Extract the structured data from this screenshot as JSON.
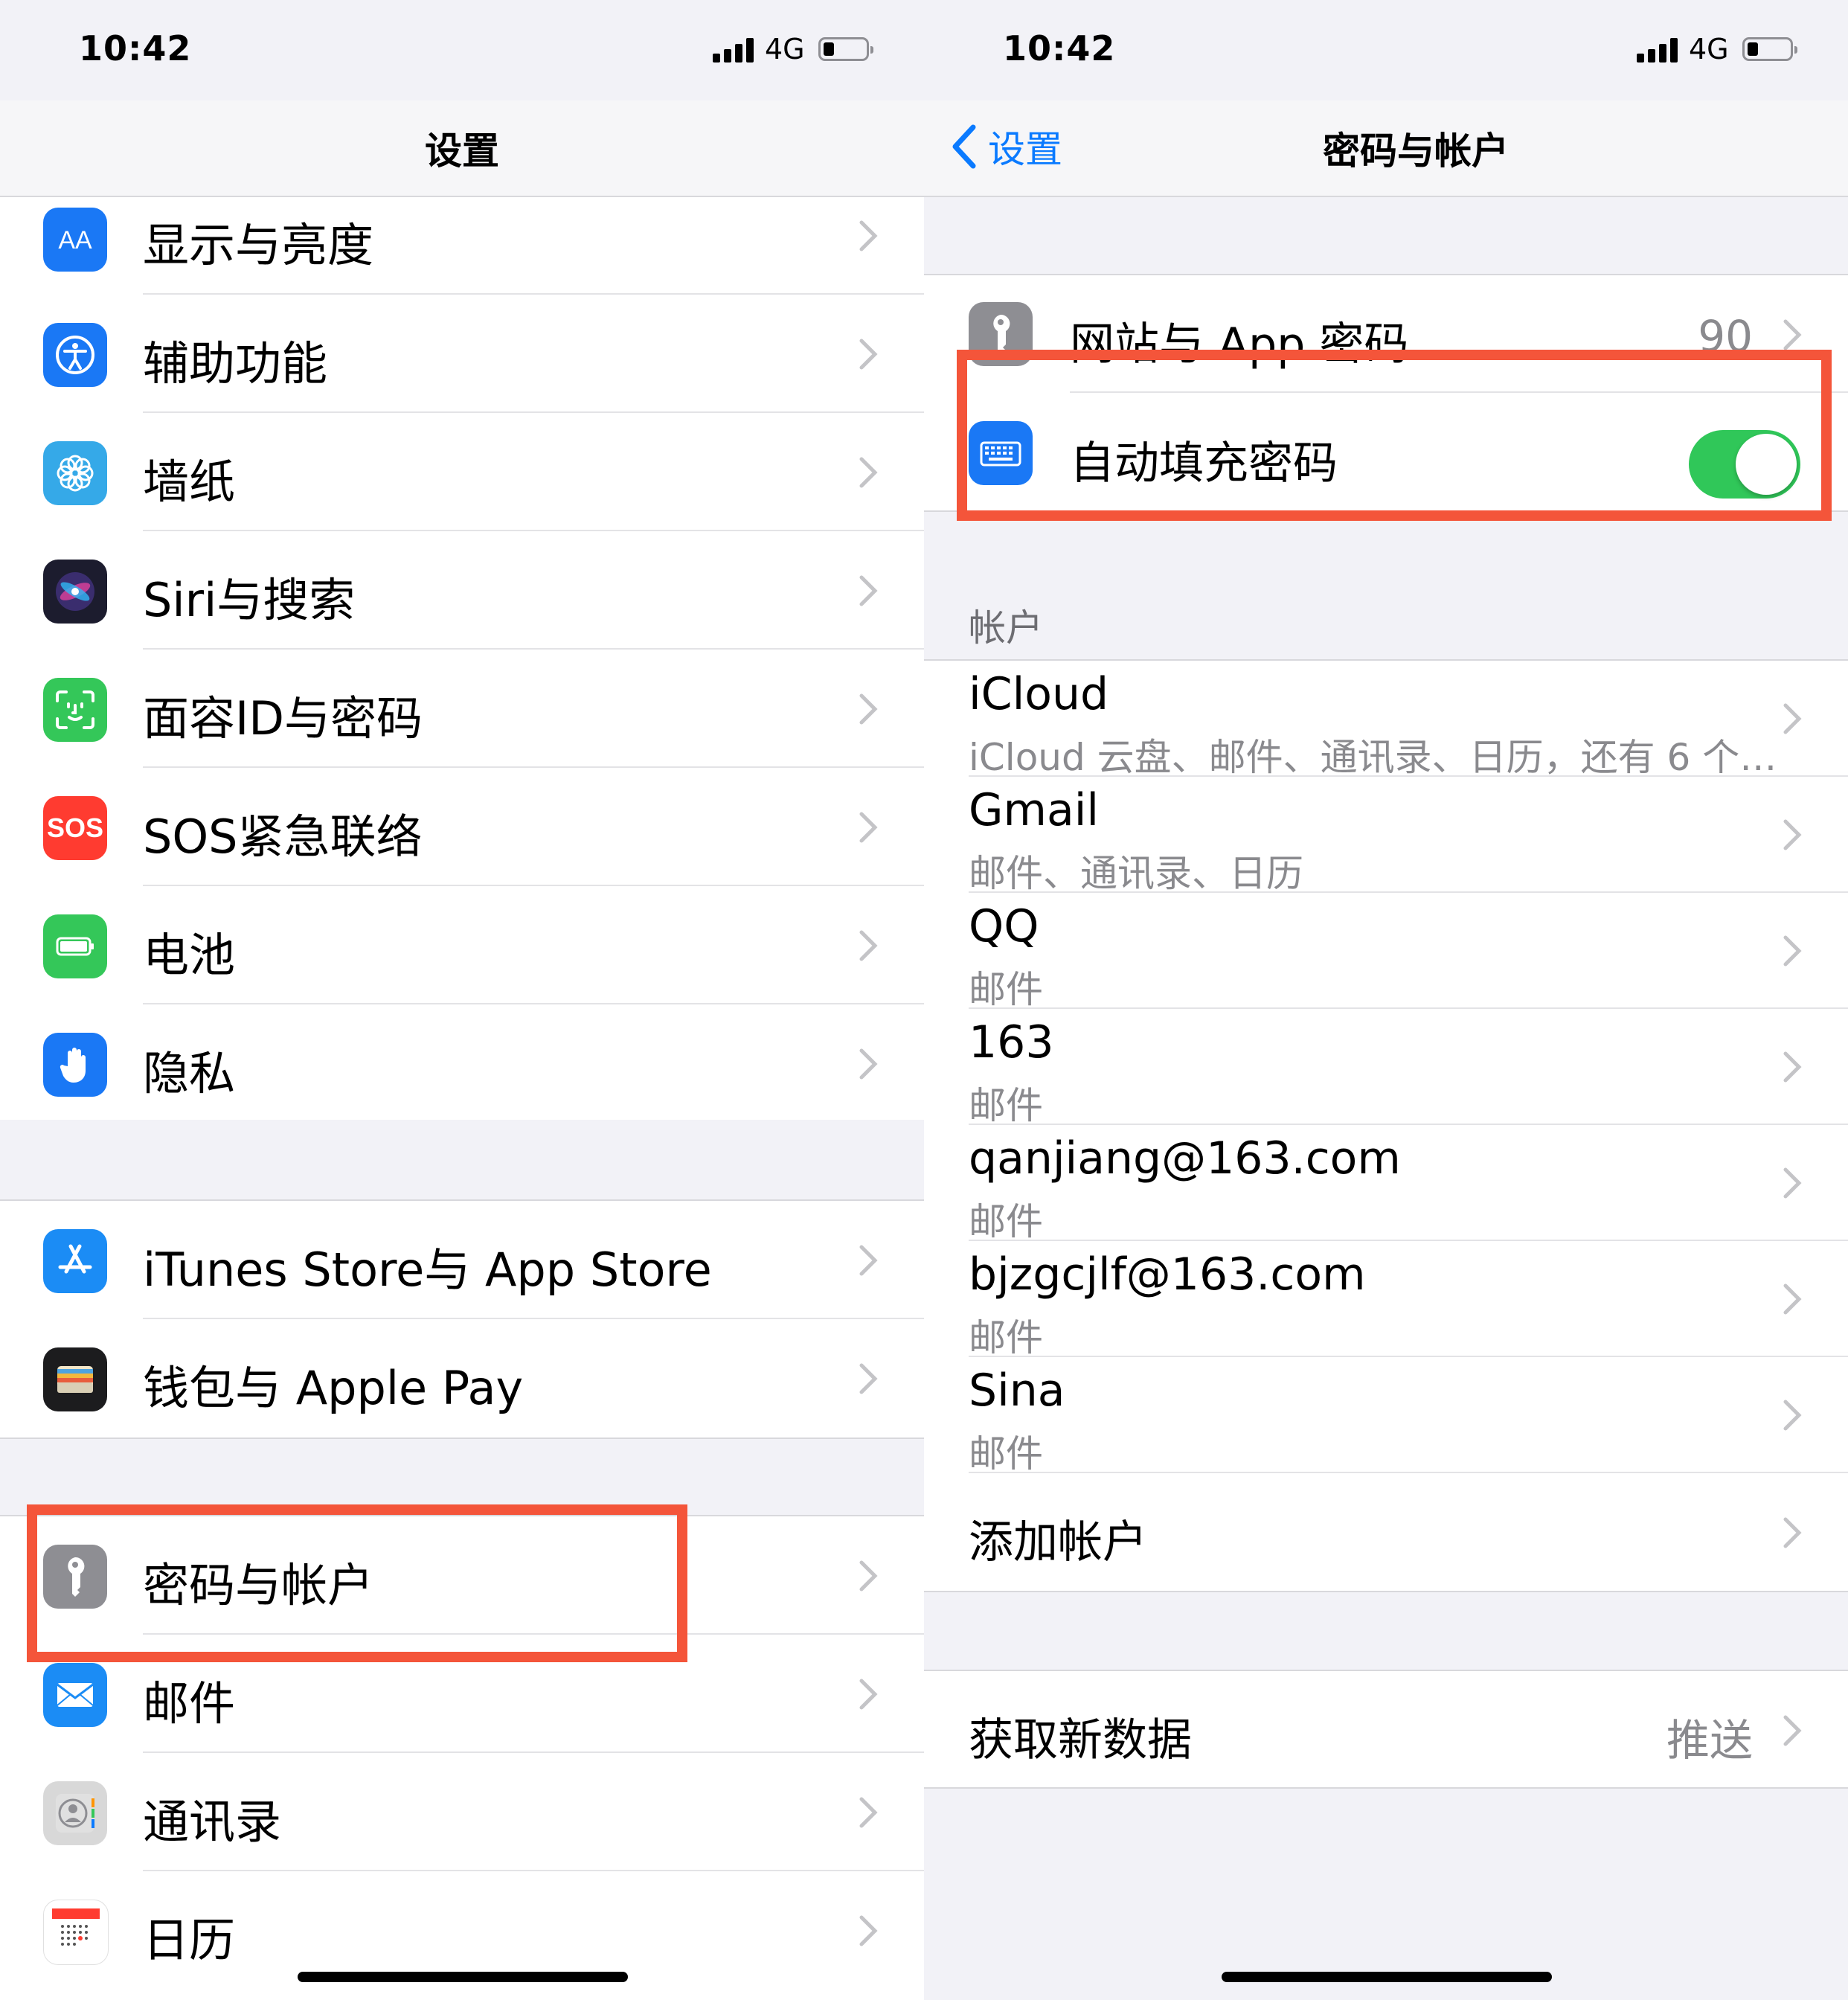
{
  "status": {
    "time": "10:42",
    "network": "4G"
  },
  "left": {
    "title": "设置",
    "group1": [
      {
        "label": "显示与亮度",
        "icon": "text-size-icon",
        "color": "#1a78f5"
      },
      {
        "label": "辅助功能",
        "icon": "accessibility-icon",
        "color": "#1a78f5"
      },
      {
        "label": "墙纸",
        "icon": "flower-icon",
        "color": "#35a9e8"
      },
      {
        "label": "Siri与搜索",
        "icon": "siri-icon",
        "color": "#1c1c2e"
      },
      {
        "label": "面容ID与密码",
        "icon": "face-id-icon",
        "color": "#34c759"
      },
      {
        "label": "SOS紧急联络",
        "icon": "sos-icon",
        "sos_text": "SOS",
        "color": "#ff3b30"
      },
      {
        "label": "电池",
        "icon": "battery-icon",
        "color": "#34c759"
      },
      {
        "label": "隐私",
        "icon": "hand-icon",
        "color": "#1a78f5"
      }
    ],
    "group2": [
      {
        "label": "iTunes Store与 App Store",
        "icon": "app-store-icon",
        "color": "#1b8cf5"
      },
      {
        "label": "钱包与 Apple Pay",
        "icon": "wallet-icon",
        "color": "#1c1c1e"
      }
    ],
    "group3": [
      {
        "label": "密码与帐户",
        "icon": "key-icon",
        "color": "#8e8e93"
      },
      {
        "label": "邮件",
        "icon": "mail-icon",
        "color": "#1b8cf5"
      },
      {
        "label": "通讯录",
        "icon": "contacts-icon",
        "color": "#d8d8d8"
      },
      {
        "label": "日历",
        "icon": "calendar-icon",
        "color": "#ffffff"
      }
    ]
  },
  "right": {
    "back_label": "设置",
    "title": "密码与帐户",
    "passwords": {
      "label": "网站与 App 密码",
      "count": "90"
    },
    "autofill": {
      "label": "自动填充密码",
      "on": true
    },
    "accounts_header": "帐户",
    "accounts": [
      {
        "name": "iCloud",
        "detail": "iCloud 云盘、邮件、通讯录、日历，还有 6 个…"
      },
      {
        "name": "Gmail",
        "detail": "邮件、通讯录、日历"
      },
      {
        "name": "QQ",
        "detail": "邮件"
      },
      {
        "name": "163",
        "detail": "邮件"
      },
      {
        "name": "qanjiang@163.com",
        "detail": "邮件"
      },
      {
        "name": "bjzgcjlf@163.com",
        "detail": "邮件"
      },
      {
        "name": "Sina",
        "detail": "邮件"
      }
    ],
    "add_account": "添加帐户",
    "fetch": {
      "label": "获取新数据",
      "value": "推送"
    }
  },
  "colors": {
    "highlight": "#f4553a",
    "tint": "#0a7aff",
    "toggle_on": "#30c759"
  }
}
